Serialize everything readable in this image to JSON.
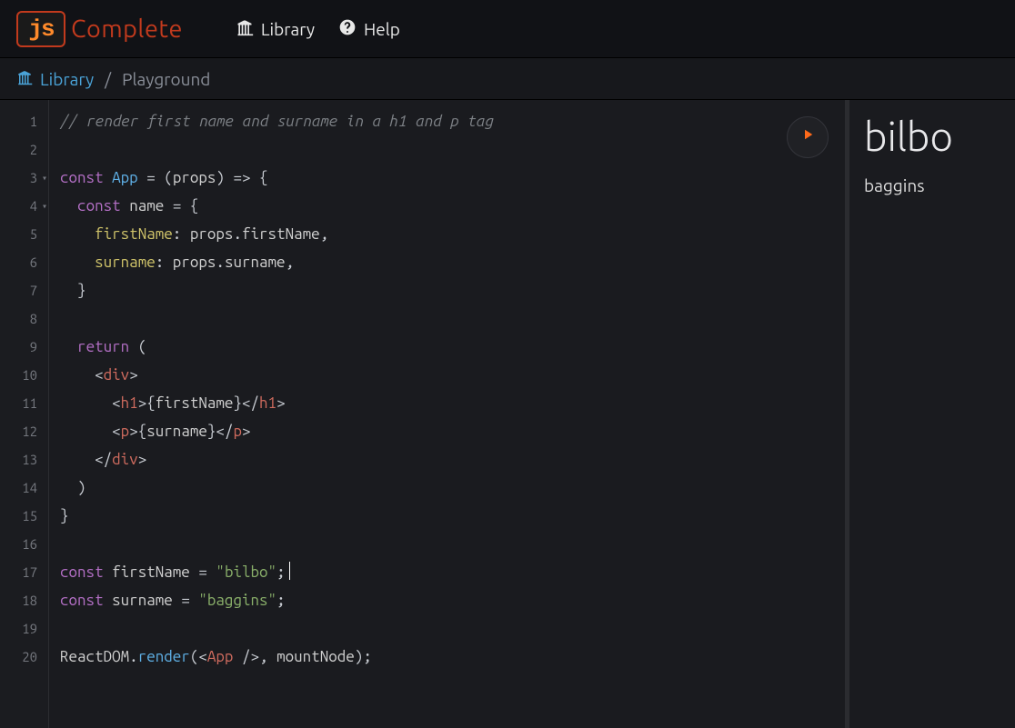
{
  "brand": {
    "box": "js",
    "text": "Complete"
  },
  "nav": {
    "library": "Library",
    "help": "Help"
  },
  "breadcrumb": {
    "library": "Library",
    "sep": "/",
    "current": "Playground"
  },
  "editor": {
    "lineCount": 20,
    "foldLines": [
      3,
      4
    ],
    "code": {
      "l1_comment": "// render first name and surname in a h1 and p tag",
      "const": "const",
      "return": "return",
      "App": "App",
      "props": "props",
      "name": "name",
      "firstNameKey": "firstName",
      "surnameKey": "surname",
      "firstNameVar": "firstName",
      "surnameVar": "surname",
      "div": "div",
      "h1": "h1",
      "p": "p",
      "ReactDOM": "ReactDOM",
      "render": "render",
      "mountNode": "mountNode",
      "strBilbo": "\"bilbo\"",
      "strBaggins": "\"baggins\""
    }
  },
  "output": {
    "h1": "bilbo",
    "p": "baggins"
  },
  "icons": {
    "library": "library-icon",
    "help": "help-icon",
    "run": "play-icon"
  }
}
